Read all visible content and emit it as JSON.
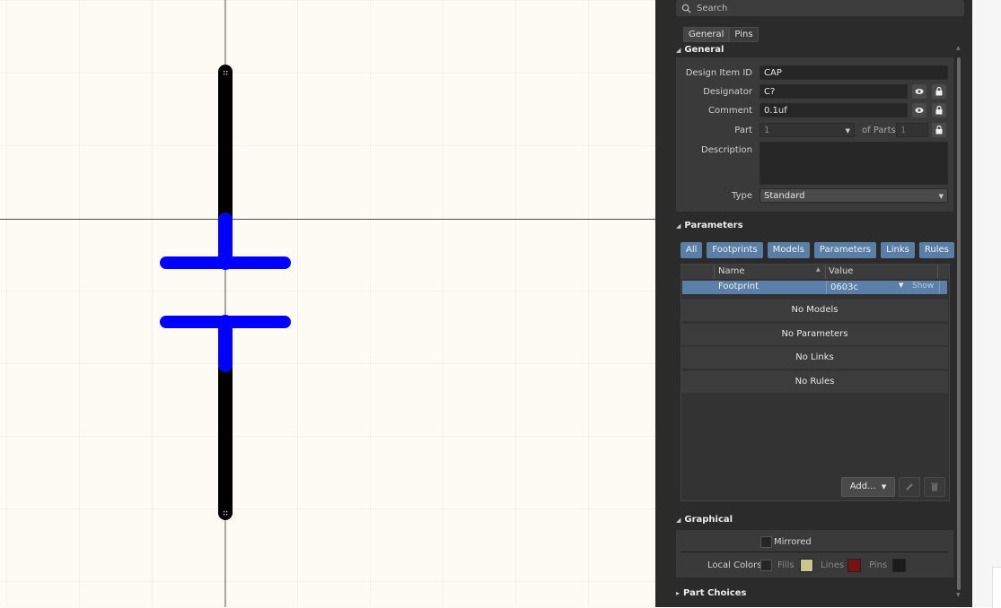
{
  "search": {
    "placeholder": "Search"
  },
  "tabs": [
    {
      "label": "General",
      "active": true
    },
    {
      "label": "Pins",
      "active": false
    }
  ],
  "general": {
    "header": "General",
    "design_item_id_label": "Design Item ID",
    "design_item_id_value": "CAP",
    "designator_label": "Designator",
    "designator_value": "C?",
    "comment_label": "Comment",
    "comment_value": "0.1uf",
    "part_label": "Part",
    "part_value": "1",
    "of_parts_label": "of Parts",
    "of_parts_value": "1",
    "description_label": "Description",
    "description_value": "",
    "type_label": "Type",
    "type_value": "Standard"
  },
  "parameters": {
    "header": "Parameters",
    "filters": [
      "All",
      "Footprints",
      "Models",
      "Parameters",
      "Links",
      "Rules"
    ],
    "columns": {
      "name": "Name",
      "value": "Value"
    },
    "rows": [
      {
        "name": "Footprint",
        "value": "0603c",
        "action": "Show"
      }
    ],
    "empty_rows": [
      "No Models",
      "No Parameters",
      "No Links",
      "No Rules"
    ],
    "add_label": "Add..."
  },
  "graphical": {
    "header": "Graphical",
    "mirrored_label": "Mirrored",
    "local_colors_label": "Local Colors",
    "fills_label": "Fills",
    "lines_label": "Lines",
    "pins_label": "Pins",
    "colors": {
      "fills": "#c9c68f",
      "lines": "#7a1212",
      "pins": "#1b1b1b"
    }
  },
  "part_choices": {
    "header": "Part Choices"
  },
  "colors": {
    "pin": "#000000",
    "body": "#0000ff",
    "accent": "#5a7fa6"
  }
}
